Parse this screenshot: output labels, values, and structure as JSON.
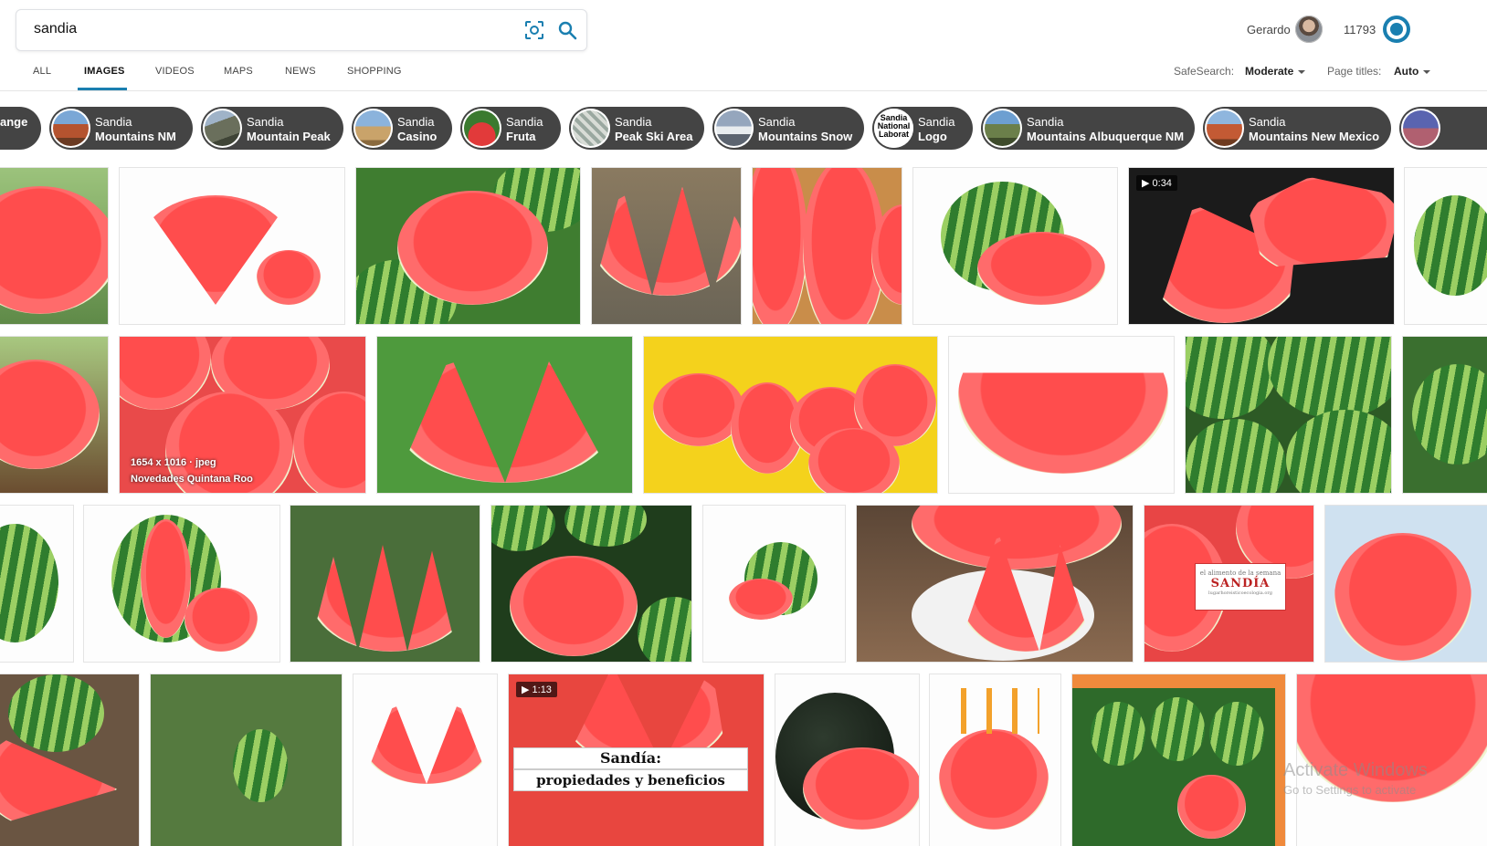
{
  "search": {
    "query": "sandia"
  },
  "user": {
    "name": "Gerardo",
    "points": "11793"
  },
  "tabs": [
    {
      "label": "ALL"
    },
    {
      "label": "IMAGES"
    },
    {
      "label": "VIDEOS"
    },
    {
      "label": "MAPS"
    },
    {
      "label": "NEWS"
    },
    {
      "label": "SHOPPING"
    }
  ],
  "filters": {
    "safesearch_label": "SafeSearch:",
    "safesearch_value": "Moderate",
    "page_titles_label": "Page titles:",
    "page_titles_value": "Auto"
  },
  "related": [
    {
      "line1": "",
      "line2": "ange"
    },
    {
      "line1": "Sandia",
      "line2": "Mountains NM"
    },
    {
      "line1": "Sandia",
      "line2": "Mountain Peak"
    },
    {
      "line1": "Sandia",
      "line2": "Casino"
    },
    {
      "line1": "Sandia",
      "line2": "Fruta"
    },
    {
      "line1": "Sandia",
      "line2": "Peak Ski Area"
    },
    {
      "line1": "Sandia",
      "line2": "Mountains Snow"
    },
    {
      "line1": "Sandia",
      "line2": "Logo"
    },
    {
      "line1": "Sandia",
      "line2": "Mountains Albuquerque NM"
    },
    {
      "line1": "Sandia",
      "line2": "Mountains New Mexico"
    }
  ],
  "logo_chip_text": "Sandia National Laborat",
  "images": {
    "video1_duration": "0:34",
    "video2_duration": "1:13",
    "hover_dims": "1654 x 1016 · jpeg",
    "hover_source": "Novedades Quintana Roo",
    "overlay_title_1": "Sandía:",
    "overlay_title_2": "propiedades y beneficios",
    "card_small": "el alimento de la semana",
    "card_big": "SANDÍA",
    "card_url": "lugarhoreisticoecologia.org"
  },
  "system": {
    "activate_title": "Activate Windows",
    "activate_sub": "Go to Settings to activate"
  }
}
